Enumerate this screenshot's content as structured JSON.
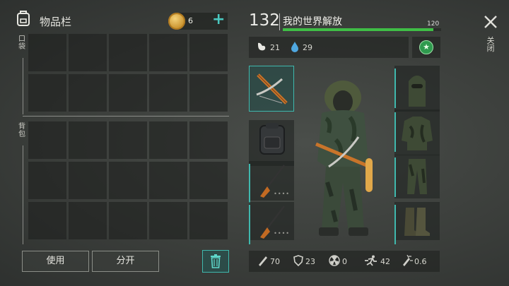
{
  "inventory": {
    "title": "物品栏",
    "pocket_label": "口袋",
    "backpack_label": "背包",
    "coin_count": "6",
    "add_label": "+",
    "use_button": "使用",
    "split_button": "分开"
  },
  "player": {
    "level": "132",
    "name": "我的世界解放",
    "hp_max": "120",
    "hp_fraction": 0.95,
    "hunger": "21",
    "thirst": "29"
  },
  "close_label": "关闭",
  "stats": {
    "damage": "70",
    "armor": "23",
    "radiation": "0",
    "speed": "42",
    "noise": "0.6"
  },
  "colors": {
    "accent": "#3fb8ad",
    "health": "#3fbe46",
    "badge": "#2f9a4e"
  },
  "equipment_icons": [
    "crossbow-icon",
    "backpack-icon",
    "rifle-icon",
    "rifle-icon",
    "balaclava-icon",
    "ghillie-jacket-icon",
    "ghillie-pants-icon",
    "boots-icon"
  ]
}
